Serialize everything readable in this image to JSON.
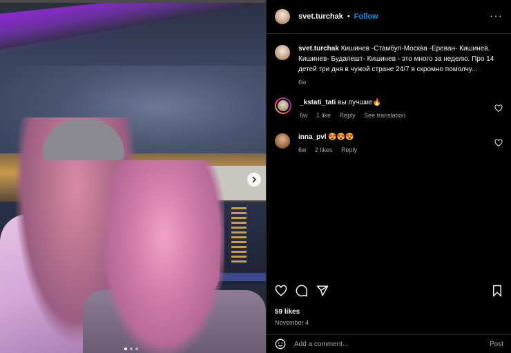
{
  "post": {
    "author": "svet.turchak",
    "follow_label": "Follow",
    "separator": "•",
    "more_label": "···",
    "caption_user": "svet.turchak",
    "caption_text": "Кишинев -Стамбул-Москва -Ереван- Кишинев. Кишинев- Будапешт- Кишинев - это много за неделю. Про 14 детей три дня в чужой стране 24/7 я скромно помолчу...",
    "caption_age": "6w",
    "likes": "59 likes",
    "date": "November 4",
    "carousel": {
      "count": 3,
      "active_index": 0
    }
  },
  "comments": [
    {
      "user": "_kstati_tati",
      "text": "вы лучшие🔥",
      "age": "6w",
      "likes": "1 like",
      "reply": "Reply",
      "translation": "See translation"
    },
    {
      "user": "inna_pvl",
      "text": "😍😍😍",
      "age": "6w",
      "likes": "2 likes",
      "reply": "Reply"
    }
  ],
  "add_comment": {
    "placeholder": "Add a comment...",
    "post_label": "Post"
  },
  "icons": [
    "next-arrow-icon",
    "heart-icon",
    "comment-icon",
    "share-icon",
    "save-icon",
    "emoji-icon"
  ],
  "colors": {
    "link": "#0095f6",
    "text": "#f5f5f5",
    "secondary": "#a8a8a8",
    "background": "#000000"
  }
}
